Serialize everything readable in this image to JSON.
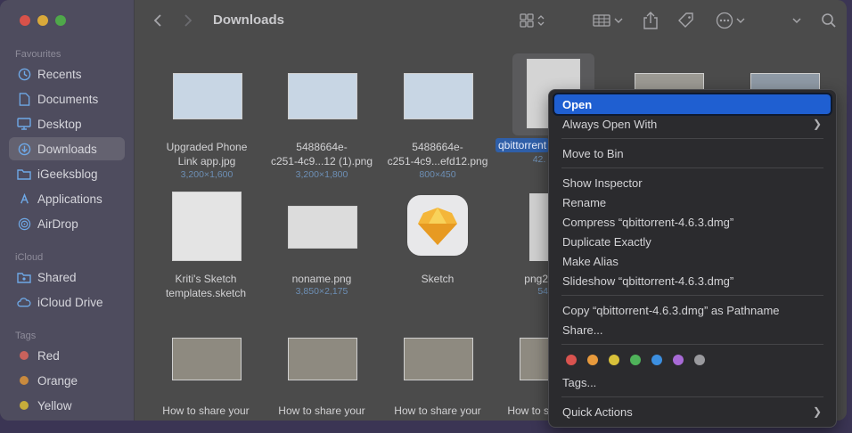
{
  "sidebar": {
    "favourites_header": "Favourites",
    "favourites": [
      {
        "label": "Recents",
        "icon": "clock-icon"
      },
      {
        "label": "Documents",
        "icon": "document-icon"
      },
      {
        "label": "Desktop",
        "icon": "desktop-icon"
      },
      {
        "label": "Downloads",
        "icon": "download-icon",
        "active": true
      },
      {
        "label": "iGeeksblog",
        "icon": "folder-icon"
      },
      {
        "label": "Applications",
        "icon": "applications-icon"
      },
      {
        "label": "AirDrop",
        "icon": "airdrop-icon"
      }
    ],
    "icloud_header": "iCloud",
    "icloud": [
      {
        "label": "Shared",
        "icon": "shared-folder-icon"
      },
      {
        "label": "iCloud Drive",
        "icon": "cloud-icon"
      }
    ],
    "tags_header": "Tags",
    "tags": [
      {
        "label": "Red",
        "color": "#c9625c"
      },
      {
        "label": "Orange",
        "color": "#c98a3e"
      },
      {
        "label": "Yellow",
        "color": "#c7ad3a"
      }
    ]
  },
  "toolbar": {
    "title": "Downloads",
    "icons": [
      "back-icon",
      "forward-icon",
      "grid-view-icon",
      "group-icon",
      "share-icon",
      "tag-icon",
      "more-icon",
      "chevron-down-icon",
      "search-icon"
    ]
  },
  "files": [
    {
      "name1": "Upgraded Phone",
      "name2": "Link app.jpg",
      "meta": "3,200×1,600"
    },
    {
      "name1": "5488664e-",
      "name2": "c251-4c9...12 (1).png",
      "meta": "3,200×1,800"
    },
    {
      "name1": "5488664e-",
      "name2": "c251-4c9...efd12.png",
      "meta": "800×450"
    },
    {
      "name1": "qbittorrent",
      "name2": "",
      "meta": "42."
    },
    {
      "name1": "Kriti's Sketch",
      "name2": "templates.sketch",
      "meta": ""
    },
    {
      "name1": "noname.png",
      "name2": "",
      "meta": "3,850×2,175"
    },
    {
      "name1": "Sketch",
      "name2": "",
      "meta": ""
    },
    {
      "name1": "png2",
      "name2": "",
      "meta": "54"
    },
    {
      "name1": "How to share your",
      "name2": "",
      "meta": ""
    },
    {
      "name1": "How to share your",
      "name2": "",
      "meta": ""
    },
    {
      "name1": "How to share your",
      "name2": "",
      "meta": ""
    },
    {
      "name1": "How to s",
      "name2": "",
      "meta": ""
    }
  ],
  "context_menu": {
    "open": "Open",
    "always_open_with": "Always Open With",
    "move_to_bin": "Move to Bin",
    "show_inspector": "Show Inspector",
    "rename": "Rename",
    "compress": "Compress “qbittorrent-4.6.3.dmg”",
    "duplicate_exactly": "Duplicate Exactly",
    "make_alias": "Make Alias",
    "slideshow": "Slideshow “qbittorrent-4.6.3.dmg”",
    "copy_pathname": "Copy “qbittorrent-4.6.3.dmg” as Pathname",
    "share": "Share...",
    "tags": "Tags...",
    "quick_actions": "Quick Actions",
    "tag_colors": [
      "#d9534f",
      "#e89a3c",
      "#d9c13a",
      "#4fb35a",
      "#3c8fe0",
      "#a86ad6",
      "#9a9a9e"
    ]
  }
}
